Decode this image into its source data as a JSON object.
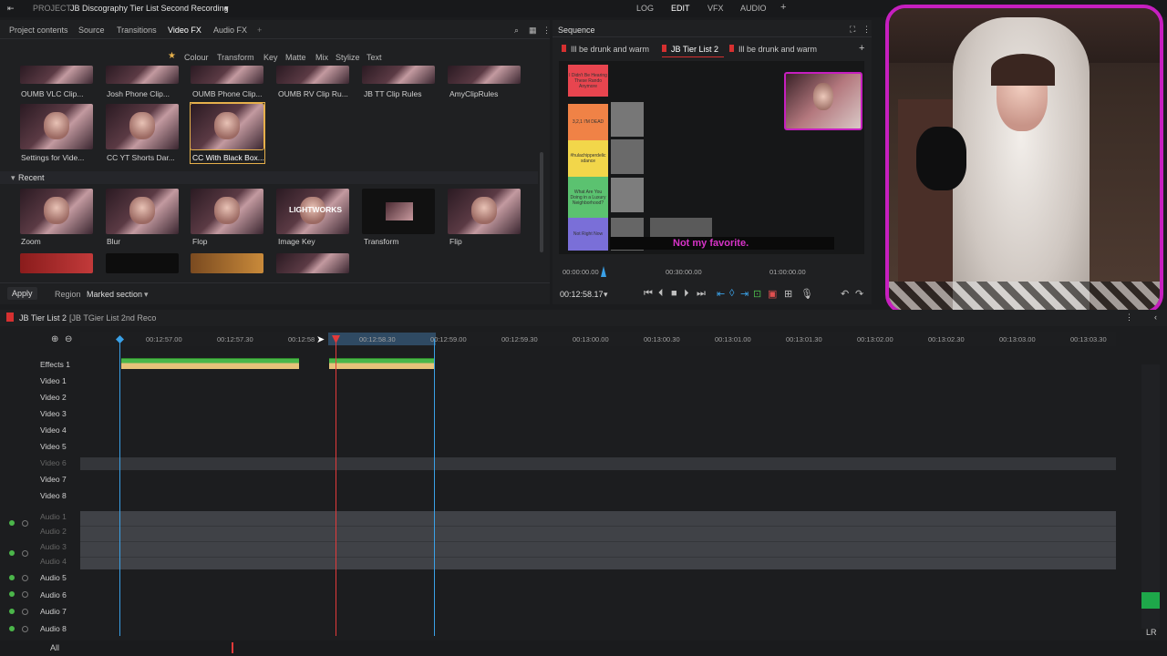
{
  "topbar": {
    "project_label": "PROJECT",
    "project_name": "JB Discography Tier List Second Recording",
    "modes": [
      "LOG",
      "EDIT",
      "VFX",
      "AUDIO"
    ],
    "add": "+"
  },
  "lib_tabs": [
    "Project contents",
    "Source",
    "Transitions",
    "Video FX",
    "Audio FX",
    "+"
  ],
  "fx_cats": [
    "Colour",
    "Transform",
    "Key",
    "Matte",
    "Mix",
    "Stylize",
    "Text"
  ],
  "fx_row1": [
    "OUMB VLC Clip...",
    "Josh Phone Clip...",
    "OUMB Phone Clip...",
    "OUMB RV Clip Ru...",
    "JB TT Clip Rules",
    "AmyClipRules"
  ],
  "fx_row2": [
    "Settings for Vide...",
    "CC YT Shorts Dar...",
    "CC With Black Box..."
  ],
  "recent_label": "Recent",
  "recent": [
    "Zoom",
    "Blur",
    "Flop",
    "Image Key",
    "Transform",
    "Flip"
  ],
  "lightworks_label": "LIGHTWORKS",
  "apply": "Apply",
  "region_label": "Region",
  "region_value": "Marked section",
  "sequence": {
    "title": "Sequence",
    "tabs": [
      "Ill be drunk and warm",
      "JB Tier List 2",
      "Ill be drunk and warm"
    ],
    "subtitle": "Not my favorite.",
    "time_start": "00:00:00.00",
    "time_mid": "00:30:00.00",
    "time_end": "01:00:00.00",
    "current": "00:12:58.17"
  },
  "tiers": [
    {
      "label": "I Didn't Be Hearing These Rando Anymore",
      "color": "#e8454f"
    },
    {
      "label": "3,2,1 I'M DEAD",
      "color": "#f08246"
    },
    {
      "label": "#hulachipperdelic sdance",
      "color": "#f2d64a"
    },
    {
      "label": "What Are You Doing in a Luxury Neighborhood?",
      "color": "#5bc270"
    },
    {
      "label": "Not Right Now",
      "color": "#7a6fd8"
    }
  ],
  "timeline": {
    "name": "JB Tier List 2",
    "subname": "[JB TGier List 2nd Reco",
    "tracks": [
      "Effects 1",
      "Video 1",
      "Video 2",
      "Video 3",
      "Video 4",
      "Video 5",
      "Video 6",
      "Video 7",
      "Video 8"
    ],
    "audio": [
      "Audio 1",
      "Audio 2",
      "Audio 3",
      "Audio 4",
      "Audio 5",
      "Audio 6",
      "Audio 7",
      "Audio 8"
    ],
    "ticks": [
      "00:12:57.00",
      "00:12:57.30",
      "00:12:58",
      "00:12:58.30",
      "00:12:59.00",
      "00:12:59.30",
      "00:13:00.00",
      "00:13:00.30",
      "00:13:01.00",
      "00:13:01.30",
      "00:13:02.00",
      "00:13:02.30",
      "00:13:03.00",
      "00:13:03.30"
    ],
    "all": "All",
    "lr": "LR"
  },
  "colors": {
    "accent": "#e6b04b",
    "playhead": "#e23a3a",
    "marker": "#3aa0e6",
    "magenta": "#c61fbf"
  }
}
